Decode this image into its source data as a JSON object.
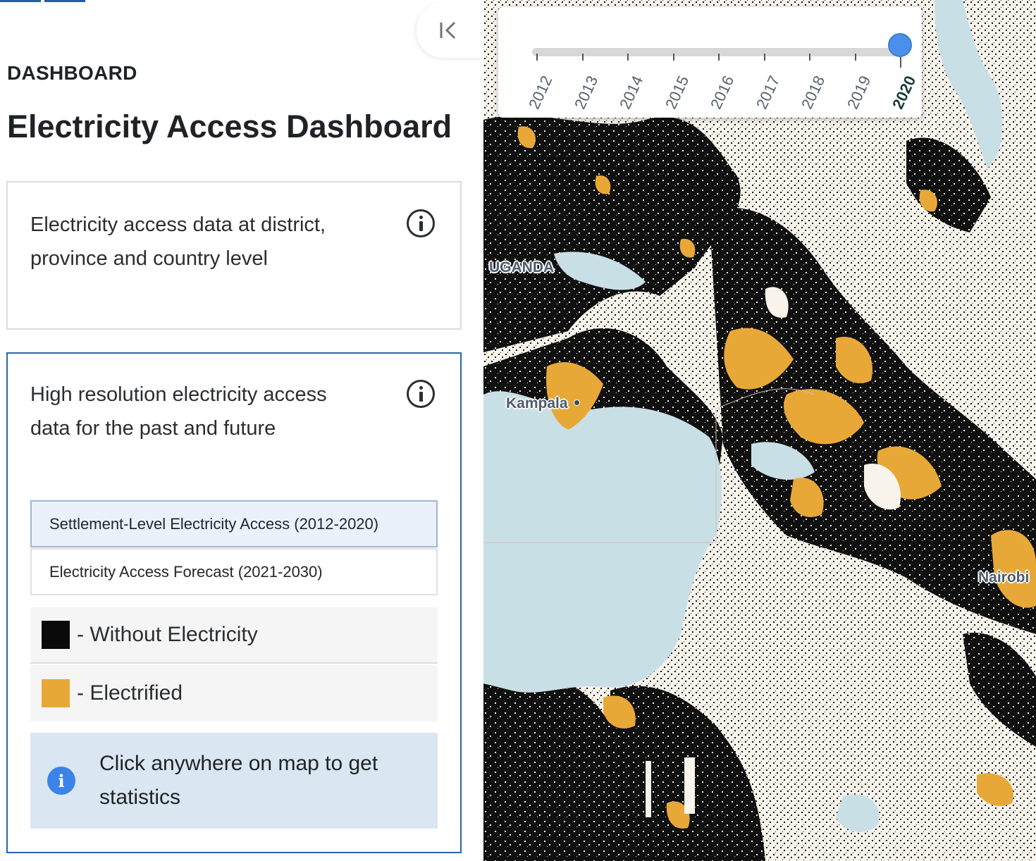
{
  "sidebar": {
    "section_label": "DASHBOARD",
    "title": "Electricity Access Dashboard",
    "collapse_icon": "collapse-left-icon",
    "cards": [
      {
        "text": "Electricity access data at district, province and country level",
        "info_icon": "info-circle-icon"
      },
      {
        "text": "High resolution electricity access data for the past and future",
        "info_icon": "info-circle-icon",
        "layers": [
          {
            "label": "Settlement-Level Electricity Access (2012-2020)",
            "selected": true
          },
          {
            "label": "Electricity Access Forecast (2021-2030)",
            "selected": false
          }
        ],
        "legend": [
          {
            "label": "- Without Electricity",
            "color": "#0a0a0a"
          },
          {
            "label": "- Electrified",
            "color": "#e8a838"
          }
        ],
        "notice": {
          "icon": "info-filled-icon",
          "icon_glyph": "i",
          "text": "Click anywhere on map to get statistics"
        }
      }
    ]
  },
  "timeline": {
    "years": [
      "2012",
      "2013",
      "2014",
      "2015",
      "2016",
      "2017",
      "2018",
      "2019",
      "2020"
    ],
    "selected": "2020",
    "accent": "#4a90ea"
  },
  "map": {
    "labels": {
      "country": "UGANDA",
      "city_1": "Kampala",
      "city_2": "Nairobi"
    },
    "colors": {
      "background": "#f8f4ec",
      "water": "#c9dfe6",
      "without_electricity": "#0a0a0a",
      "electrified": "#e8a838"
    }
  }
}
